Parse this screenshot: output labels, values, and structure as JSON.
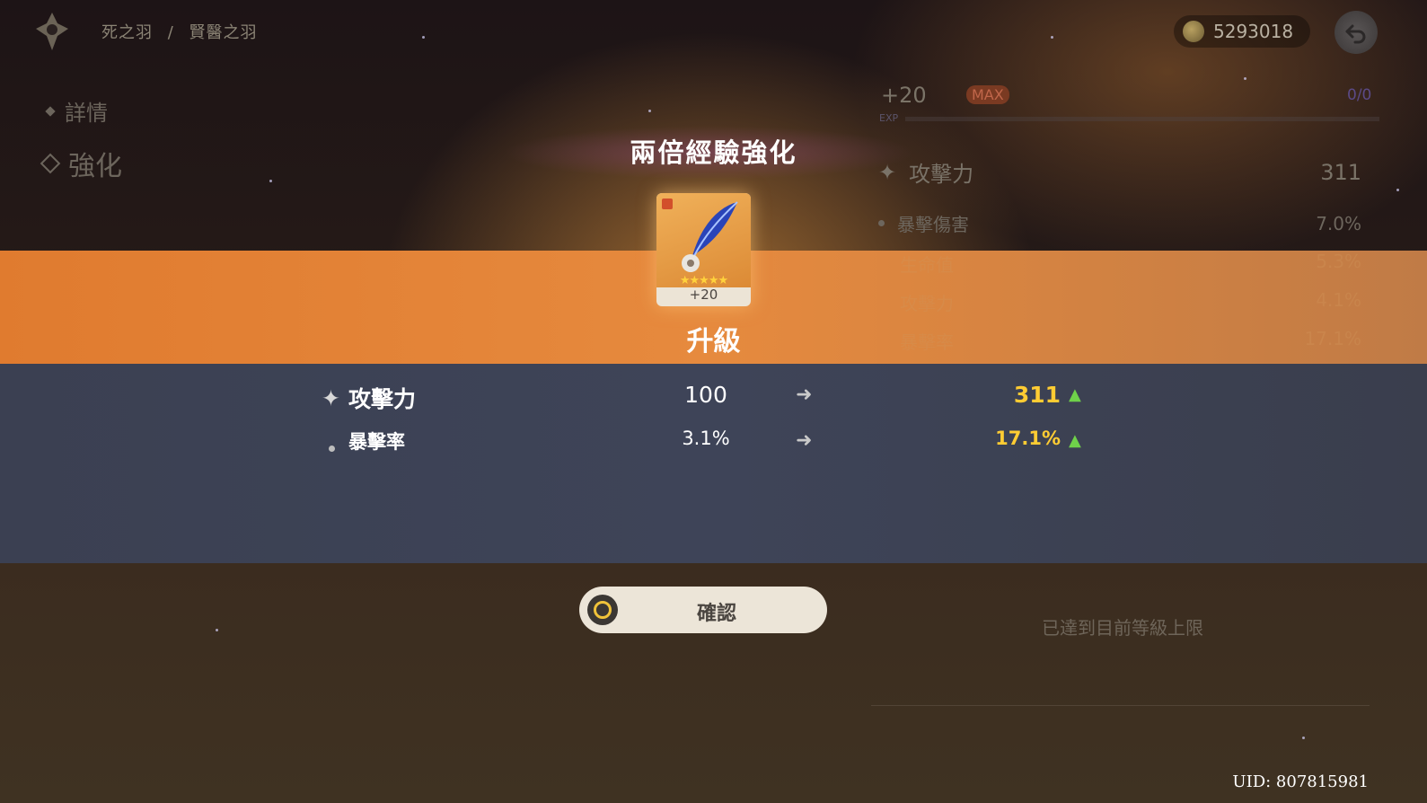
{
  "breadcrumb": {
    "parent": "死之羽",
    "separator": "/",
    "current": "賢醫之羽"
  },
  "side_tabs": {
    "details": "詳情",
    "enhance": "強化"
  },
  "currency": {
    "mora": "5293018"
  },
  "right_panel": {
    "level": "+20",
    "max_badge": "MAX",
    "exp_count": "0/0",
    "exp_label": "EXP",
    "main_stat": {
      "name": "攻擊力",
      "value": "311"
    },
    "sub_stats": [
      {
        "name": "暴擊傷害",
        "value": "7.0%"
      },
      {
        "name": "生命值",
        "value": "5.3%"
      },
      {
        "name": "攻擊力",
        "value": "4.1%"
      },
      {
        "name": "暴擊率",
        "value": "17.1%"
      }
    ],
    "max_note": "已達到目前等級上限"
  },
  "popup": {
    "title": "兩倍經驗強化",
    "item_level": "+20",
    "item_stars": "★★★★★",
    "result_label": "升級",
    "stats": [
      {
        "name": "攻擊力",
        "old": "100",
        "new": "311"
      },
      {
        "name": "暴擊率",
        "old": "3.1%",
        "new": "17.1%"
      }
    ],
    "confirm_label": "確認"
  },
  "uid": "UID: 807815981",
  "colors": {
    "accent_orange": "#e68a3e",
    "stat_blue": "#3e4458",
    "highlight_yellow": "#ffcc33",
    "up_green": "#6fd14a"
  }
}
